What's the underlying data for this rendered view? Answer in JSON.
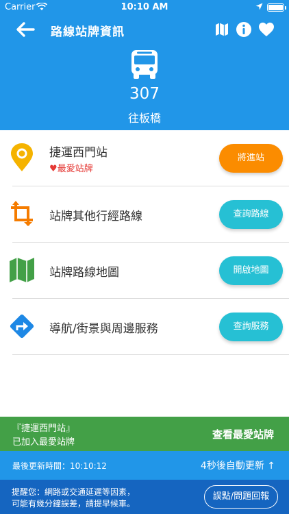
{
  "status_bar": {
    "carrier": "Carrier",
    "time": "10:10 AM"
  },
  "nav": {
    "title": "路線站牌資訊",
    "icons": [
      "back-arrow-icon",
      "map-icon",
      "info-icon",
      "heart-icon"
    ]
  },
  "bus": {
    "route_number": "307",
    "direction": "往板橋"
  },
  "rows": [
    {
      "label": "捷運西門站",
      "sublabel": "♥最愛站牌",
      "button": "將進站",
      "icon": "location-pin-icon"
    },
    {
      "label": "站牌其他行經路線",
      "button": "查詢路線",
      "icon": "crop-arrows-icon"
    },
    {
      "label": "站牌路線地圖",
      "button": "開啟地圖",
      "icon": "map-icon"
    },
    {
      "label": "導航/街景與周邊服務",
      "button": "查詢服務",
      "icon": "directions-icon"
    }
  ],
  "favorite_banner": {
    "line1": "『捷運西門站』",
    "line2": "已加入最愛站牌",
    "action": "查看最愛站牌"
  },
  "update_bar": {
    "last_update": "最後更新時間：10:10:12",
    "auto_update": "4秒後自動更新 ↑"
  },
  "footer": {
    "notice_line1": "提醒您：網路或交通延遲等因素，",
    "notice_line2": "可能有幾分鐘誤差，請提早候車。",
    "report_button": "誤點/問題回報"
  },
  "colors": {
    "header": "#2196e8",
    "orange": "#fb8c00",
    "teal": "#26c0d4",
    "green": "#43a047",
    "footer": "#1565c0",
    "pin": "#f5b300"
  }
}
